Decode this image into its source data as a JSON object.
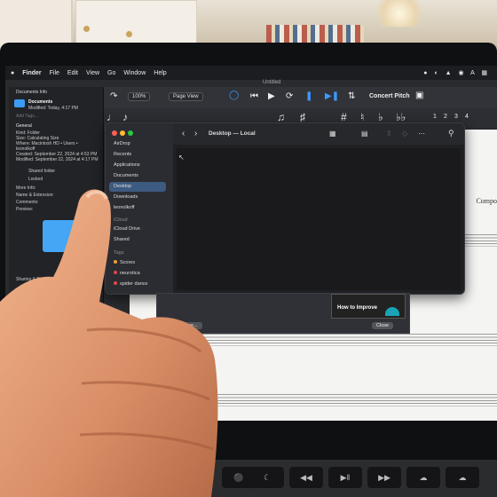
{
  "menubar": {
    "items": [
      "Finder",
      "File",
      "Edit",
      "View",
      "Go",
      "Window",
      "Help"
    ],
    "document_title": "Untitled"
  },
  "toolbar": {
    "zoom": "100%",
    "view_mode": "Page View",
    "concert_pitch": "Concert Pitch"
  },
  "palette": {
    "tuplets": [
      "1",
      "2",
      "3",
      "4"
    ]
  },
  "info_panel": {
    "title": "Documents Info",
    "name": "Documents",
    "modified": "Modified: Today, 4:17 PM",
    "add_tags": "Add Tags...",
    "general_header": "General",
    "kind": "Kind: Folder",
    "size": "Size: Calculating Size",
    "where": "Where: Macintosh HD • Users • leonolkoff",
    "created": "Created: September 22, 2024 at 4:53 PM",
    "modified_full": "Modified: September 22, 2024 at 4:17 PM",
    "shared_folder": "Shared folder",
    "locked": "Locked",
    "more_info": "More Info:",
    "name_extension": "Name & Extension:",
    "comments": "Comments:",
    "preview": "Preview:",
    "sharing": "Sharing & Permissions:"
  },
  "finder": {
    "path_title": "Desktop — Local",
    "sidebar": {
      "favorites": [
        "AirDrop",
        "Recents",
        "Applications",
        "Documents",
        "Desktop",
        "Downloads",
        "leonolkoff"
      ],
      "icloud_header": "iCloud",
      "icloud": [
        "iCloud Drive",
        "Shared"
      ],
      "tags_header": "Tags",
      "tags": [
        {
          "label": "Scores",
          "color": "#f0a030"
        },
        {
          "label": "neurotica",
          "color": "#e04848"
        },
        {
          "label": "spider dance",
          "color": "#e04848"
        }
      ]
    },
    "selected_item": "Desktop"
  },
  "lower_panel": {
    "thumbnail_label": "How to Improve",
    "open_score_button": "Open a Score...",
    "close_button": "Close"
  },
  "score": {
    "composer_partial": "Compo"
  },
  "keyboard": {
    "glyphs": [
      "☾",
      "◀◀",
      "▶‖",
      "▶▶"
    ]
  },
  "colors": {
    "accent_blue": "#3a9bff",
    "sidebar_selected": "#3d5a80"
  }
}
